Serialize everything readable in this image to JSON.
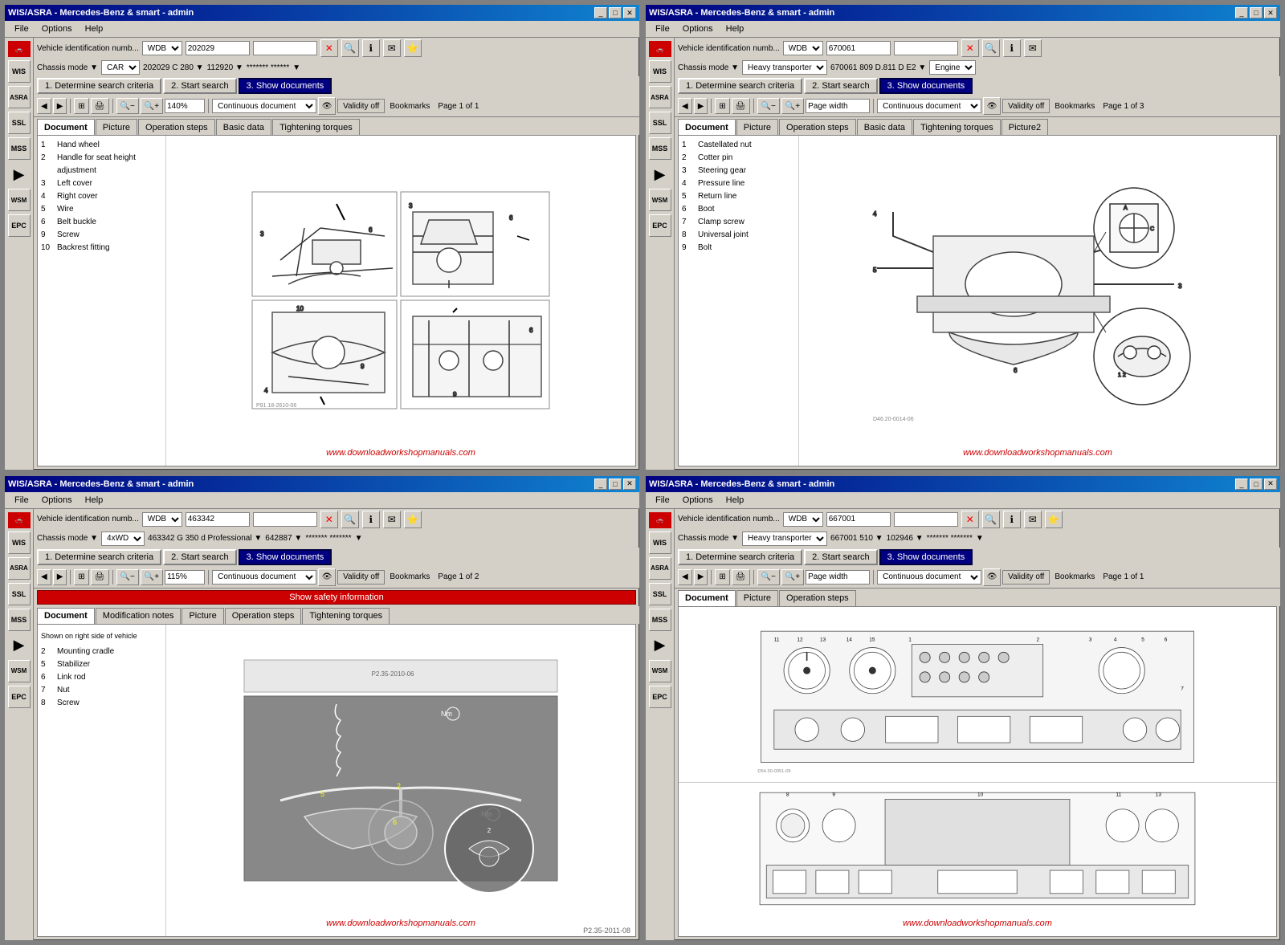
{
  "windows": [
    {
      "id": "win1",
      "title": "WIS/ASRA - Mercedes-Benz & smart - admin",
      "vehicleIdLabel": "Vehicle identification numb...",
      "wdbValue": "WDB",
      "idNumber": "202029",
      "chassisMode": "CAR",
      "chassisDetail": "202029 C 280",
      "engineCode": "112920",
      "passwordField": "******* ******",
      "steps": [
        "1. Determine search criteria",
        "2. Start search",
        "3. Show documents"
      ],
      "activeStep": 2,
      "zoom": "140%",
      "docMode": "Continuous document",
      "validityOff": "Validity off",
      "bookmarks": "Bookmarks",
      "pageInfo": "Page 1 of 1",
      "tabs": [
        "Document",
        "Picture",
        "Operation steps",
        "Basic data",
        "Tightening torques"
      ],
      "activeTab": 0,
      "docItems": [
        {
          "num": "1",
          "text": "Hand wheel"
        },
        {
          "num": "2",
          "text": "Handle for seat height adjustment"
        },
        {
          "num": "3",
          "text": "Left cover"
        },
        {
          "num": "4",
          "text": "Right cover"
        },
        {
          "num": "5",
          "text": "Wire"
        },
        {
          "num": "6",
          "text": "Belt buckle"
        },
        {
          "num": "9",
          "text": "Screw"
        },
        {
          "num": "10",
          "text": "Backrest fitting"
        }
      ],
      "pageRef": "P91.18-2610-06",
      "watermark": "www.downloadworkshopmanuals.com",
      "sidebarItems": [
        "WIS",
        "ASRA",
        "SSL",
        "MSS",
        "WSM",
        "EPC"
      ]
    },
    {
      "id": "win2",
      "title": "WIS/ASRA - Mercedes-Benz & smart - admin",
      "vehicleIdLabel": "Vehicle identification numb...",
      "wdbValue": "WDB",
      "idNumber": "670061",
      "chassisMode": "Heavy transporter",
      "chassisDetail": "670061 809 D.811 D E2",
      "engineCode": "Engine",
      "steps": [
        "1. Determine search criteria",
        "2. Start search",
        "3. Show documents"
      ],
      "activeStep": 2,
      "zoom": "Page width",
      "docMode": "Continuous document",
      "validityOff": "Validity off",
      "bookmarks": "Bookmarks",
      "pageInfo": "Page 1 of 3",
      "tabs": [
        "Document",
        "Picture",
        "Operation steps",
        "Basic data",
        "Tightening torques",
        "Picture2"
      ],
      "activeTab": 0,
      "docItems": [
        {
          "num": "1",
          "text": "Castellated nut"
        },
        {
          "num": "2",
          "text": "Cotter pin"
        },
        {
          "num": "3",
          "text": "Steering gear"
        },
        {
          "num": "4",
          "text": "Pressure line"
        },
        {
          "num": "5",
          "text": "Return line"
        },
        {
          "num": "6",
          "text": "Boot"
        },
        {
          "num": "7",
          "text": "Clamp screw"
        },
        {
          "num": "8",
          "text": "Universal joint"
        },
        {
          "num": "9",
          "text": "Bolt"
        }
      ],
      "pageRef": "D46.20-0014-06",
      "watermark": "www.downloadworkshopmanuals.com",
      "sidebarItems": [
        "WIS",
        "ASRA",
        "SSL",
        "MSS",
        "WSM",
        "EPC"
      ]
    },
    {
      "id": "win3",
      "title": "WIS/ASRA - Mercedes-Benz & smart - admin",
      "vehicleIdLabel": "Vehicle identification numb...",
      "wdbValue": "WDB",
      "idNumber": "463342",
      "chassisMode": "4xWD",
      "chassisDetail": "463342 G 350 d Professional",
      "engineCode": "642887",
      "passwordField": "******* *******",
      "steps": [
        "1. Determine search criteria",
        "2. Start search",
        "3. Show documents"
      ],
      "activeStep": 2,
      "zoom": "115%",
      "docMode": "Continuous document",
      "validityOff": "Validity off",
      "bookmarks": "Bookmarks",
      "pageInfo": "Page 1 of 2",
      "tabs": [
        "Document",
        "Modification notes",
        "Picture",
        "Operation steps",
        "Tightening torques"
      ],
      "activeTab": 0,
      "hasSafetyInfo": true,
      "safetyInfoLabel": "Show safety information",
      "shownText": "Shown on right side of vehicle",
      "docItems": [
        {
          "num": "2",
          "text": "Mounting cradle"
        },
        {
          "num": "5",
          "text": "Stabilizer"
        },
        {
          "num": "6",
          "text": "Link rod"
        },
        {
          "num": "7",
          "text": "Nut"
        },
        {
          "num": "8",
          "text": "Screw"
        }
      ],
      "pageRef": "P2.35-2011-06",
      "pageRef2": "P2.35-2011-08",
      "watermark": "www.downloadworkshopmanuals.com",
      "sidebarItems": [
        "WIS",
        "ASRA",
        "SSL",
        "MSS",
        "WSM",
        "EPC"
      ]
    },
    {
      "id": "win4",
      "title": "WIS/ASRA - Mercedes-Benz & smart - admin",
      "vehicleIdLabel": "Vehicle identification numb...",
      "wdbValue": "WDB",
      "idNumber": "667001",
      "chassisMode": "Heavy transporter",
      "chassisDetail": "667001 510",
      "engineCode": "102946",
      "passwordField": "******* *******",
      "steps": [
        "1. Determine search criteria",
        "2. Start search",
        "3. Show documents"
      ],
      "activeStep": 2,
      "zoom": "Page width",
      "docMode": "Continuous document",
      "validityOff": "Validity off",
      "bookmarks": "Bookmarks",
      "pageInfo": "Page 1 of 1",
      "tabs": [
        "Document",
        "Picture",
        "Operation steps"
      ],
      "activeTab": 0,
      "pageRef": "D54.30-0051-09",
      "watermark": "www.downloadworkshopmanuals.com",
      "sidebarItems": [
        "WIS",
        "ASRA",
        "SSL",
        "MSS",
        "WSM",
        "EPC"
      ]
    }
  ],
  "menuItems": [
    "File",
    "Options",
    "Help"
  ],
  "icons": {
    "car": "🚗",
    "back": "◀",
    "forward": "▶",
    "home": "🏠",
    "print": "🖨",
    "zoom_in": "🔍",
    "zoom_out": "🔎",
    "search": "🔍",
    "close": "✕",
    "minimize": "_",
    "maximize": "□",
    "restore": "❐",
    "bookmark": "🔖",
    "info": "ℹ",
    "prev": "⏮",
    "next": "⏭",
    "mag": "⊕"
  }
}
